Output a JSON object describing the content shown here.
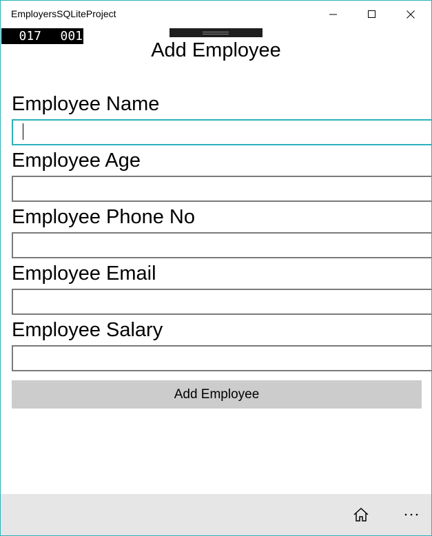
{
  "window": {
    "title": "EmployersSQLiteProject",
    "controls": {
      "minimize_icon": "minimize-icon",
      "maximize_icon": "maximize-icon",
      "close_icon": "close-icon"
    }
  },
  "frame_counter": {
    "left": "017",
    "right": "001"
  },
  "page": {
    "title": "Add Employee"
  },
  "form": {
    "fields": [
      {
        "label": "Employee Name",
        "value": "",
        "focused": true
      },
      {
        "label": "Employee Age",
        "value": ""
      },
      {
        "label": "Employee Phone No",
        "value": ""
      },
      {
        "label": "Employee Email",
        "value": ""
      },
      {
        "label": "Employee Salary",
        "value": ""
      }
    ],
    "submit_label": "Add Employee"
  },
  "appbar": {
    "home_icon": "home-icon",
    "more_icon": "more-icon",
    "more_glyph": "⋯"
  },
  "colors": {
    "accent": "#2bb1bd",
    "input_border": "#7a7a7a",
    "button_bg": "#cccccc",
    "appbar_bg": "#e6e6e6"
  }
}
